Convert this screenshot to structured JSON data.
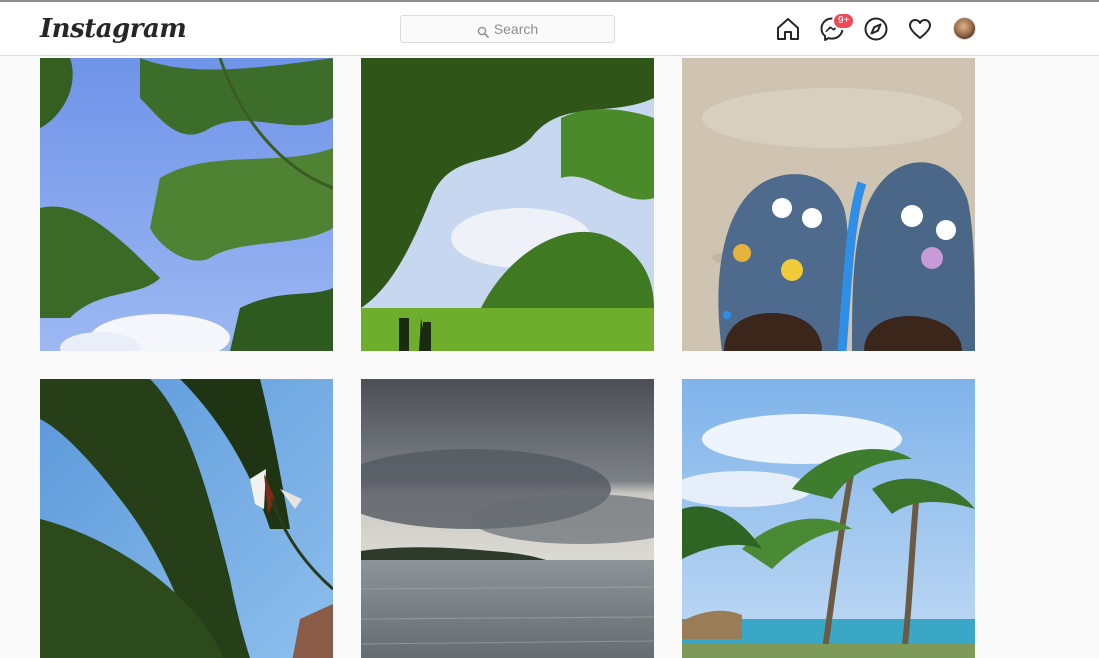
{
  "header": {
    "logo_text": "Instagram",
    "search": {
      "placeholder": "Search",
      "icon": "search-icon"
    },
    "nav": {
      "home_icon": "home-icon",
      "messenger_icon": "messenger-icon",
      "messenger_badge": "9+",
      "explore_icon": "compass-icon",
      "activity_icon": "heart-icon",
      "profile_icon": "avatar"
    }
  },
  "colors": {
    "badge": "#ed4956",
    "border": "#dbdbdb",
    "placeholder": "#8e8e8e",
    "background": "#fafafa"
  },
  "grid": {
    "posts": [
      {
        "subject": "tree branches against blue sky"
      },
      {
        "subject": "park with large trees and green lawn"
      },
      {
        "subject": "blue crocs with charms on sand"
      },
      {
        "subject": "palm fronds and flower against sky"
      },
      {
        "subject": "stormy clouds over the sea"
      },
      {
        "subject": "palm trees at a beach resort"
      }
    ]
  }
}
